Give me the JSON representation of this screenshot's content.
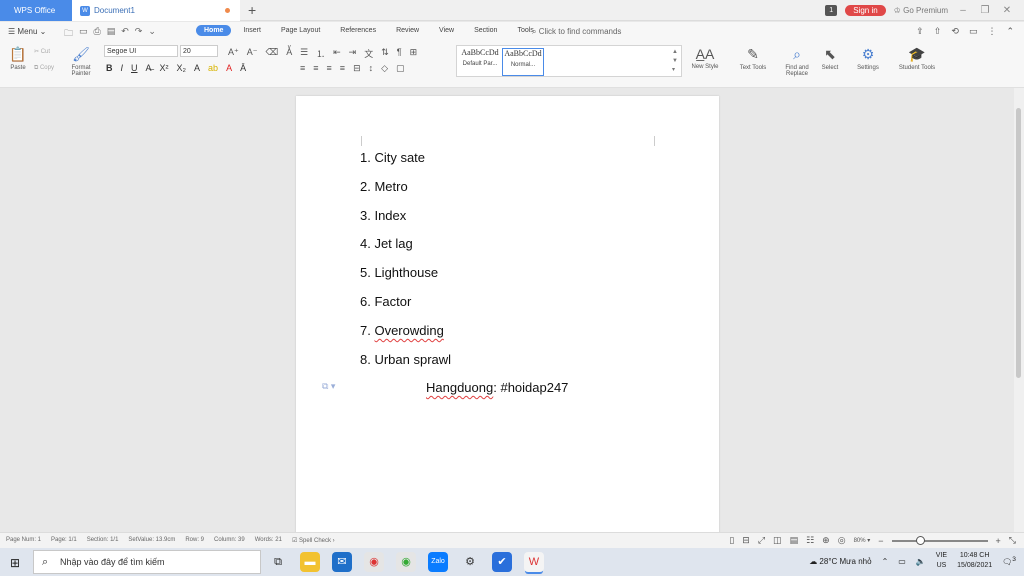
{
  "titlebar": {
    "app_tab": "WPS Office",
    "doc_tab": "Document1",
    "badge": "1",
    "signin": "Sign in",
    "premium": "Go Premium"
  },
  "menu": {
    "menu_label": "Menu",
    "tabs": [
      "Home",
      "Insert",
      "Page Layout",
      "References",
      "Review",
      "View",
      "Section",
      "Tools"
    ],
    "active_tab": "Home",
    "find_placeholder": "Click to find commands"
  },
  "ribbon": {
    "paste": "Paste",
    "cut": "Cut",
    "copy": "Copy",
    "format_painter": "Format Painter",
    "font_name": "Segoe UI",
    "font_size": "20",
    "styles": [
      {
        "preview": "AaBbCcDd",
        "caption": "Default Par..."
      },
      {
        "preview": "AaBbCcDd",
        "caption": "Normal..."
      }
    ],
    "new_style": "New Style",
    "text_tools": "Text Tools",
    "find_replace": "Find and Replace",
    "select": "Select",
    "settings": "Settings",
    "student_tools": "Student Tools"
  },
  "document": {
    "items": [
      "1. City sate",
      "2. Metro",
      "3. Index",
      "4. Jet lag",
      "5. Lighthouse",
      "6. Factor",
      "7. Overowding",
      "8. Urban sprawl"
    ],
    "signature_name": "Hangduong",
    "signature_tag": ": #hoidap247"
  },
  "statusbar": {
    "page_num": "Page Num: 1",
    "page": "Page: 1/1",
    "section": "Section: 1/1",
    "setvalue": "SetValue: 13.9cm",
    "row": "Row: 9",
    "column": "Column: 39",
    "words": "Words: 21",
    "spell_check": "Spell Check",
    "zoom": "80%",
    "zoom_level": 0.3
  },
  "taskbar": {
    "search_placeholder": "Nhập vào đây để tìm kiếm",
    "weather": "28°C Mưa nhỏ",
    "lang_line1": "VIE",
    "lang_line2": "US",
    "time": "10:48 CH",
    "date": "15/08/2021",
    "notifications": "3"
  }
}
